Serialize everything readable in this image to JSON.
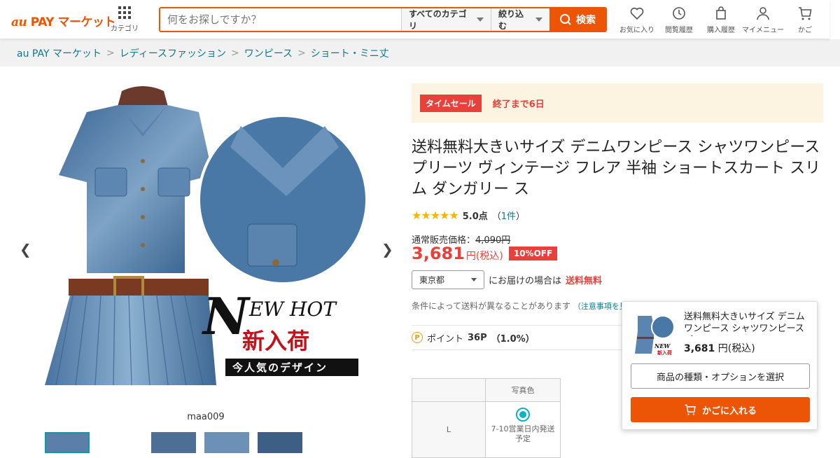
{
  "header": {
    "logo_au": "au",
    "logo_text": " PAY マーケット",
    "category_label": "カテゴリ",
    "search_placeholder": "何をお探しですか？",
    "category_select": "すべてのカテゴリ",
    "filter_select": "絞り込む",
    "search_button": "検索",
    "nav": [
      {
        "label": "お気に入り",
        "icon": "heart-icon"
      },
      {
        "label": "閲覧履歴",
        "icon": "history-icon"
      },
      {
        "label": "購入履歴",
        "icon": "bag-icon"
      },
      {
        "label": "マイメニュー",
        "icon": "user-icon"
      },
      {
        "label": "かご",
        "icon": "cart-icon"
      }
    ]
  },
  "breadcrumb": [
    "au PAY マーケット",
    "レディースファッション",
    "ワンピース",
    "ショート・ミニ丈"
  ],
  "gallery": {
    "overlay_line1": "EW HOT",
    "overlay_big_n": "N",
    "overlay_line2": "新入荷",
    "overlay_line3": "今人気のデザイン",
    "caption": "maa009",
    "thumb_count": 5
  },
  "sale": {
    "tag": "タイムセール",
    "ends": "終了まで6日"
  },
  "product": {
    "title": "送料無料大きいサイズ デニムワンピース シャツワンピース プリーツ ヴィンテージ フレア 半袖 ショートスカート スリム ダンガリー ス",
    "stars": "★★★★★",
    "score": "5.0点",
    "review_open": "（",
    "review_count": "1件",
    "review_close": "）",
    "regular_label": "通常販売価格：",
    "regular_price": "4,090円",
    "price": "3,681",
    "price_unit": "円(税込)",
    "discount": "10%OFF"
  },
  "shipping": {
    "prefecture": "東京都",
    "text": "にお届けの場合は",
    "free": "送料無料",
    "condition": "条件によって送料が異なることがあります",
    "condition_link": "（注意事項を見る）"
  },
  "points": {
    "icon_letter": "P",
    "label": "ポイント",
    "value": "36P",
    "rate": "（1.0%）"
  },
  "variation": {
    "col_header": "写真色",
    "row_label": "L",
    "ship_note": "7-10営業日内発送予定"
  },
  "sticky": {
    "title": "送料無料大きいサイズ デニムワンピース シャツワンピース プリーツ",
    "price": "3,681",
    "price_unit": " 円(税込)",
    "option_button": "商品の種類・オプションを選択",
    "cart_button": "かごに入れる"
  },
  "colors": {
    "accent": "#eb5505",
    "sale_red": "#e8403a",
    "link": "#0a7a8c"
  }
}
